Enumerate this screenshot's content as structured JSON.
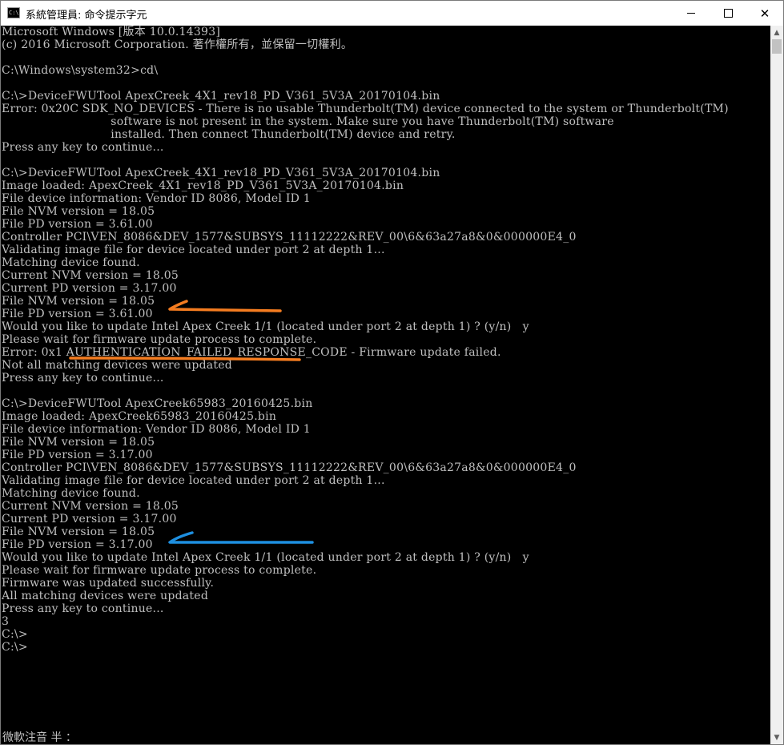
{
  "window": {
    "title": "系統管理員: 命令提示字元",
    "icon_name": "console-app-icon",
    "controls": {
      "minimize_icon": "minimize-icon",
      "maximize_icon": "maximize-icon",
      "close_icon": "close-icon"
    }
  },
  "console": {
    "lines": [
      "Microsoft Windows [版本 10.0.14393]",
      "(c) 2016 Microsoft Corporation. 著作權所有，並保留一切權利。",
      "",
      "C:\\Windows\\system32>cd\\",
      "",
      "C:\\>DeviceFWUTool ApexCreek_4X1_rev18_PD_V361_5V3A_20170104.bin",
      "Error: 0x20C SDK_NO_DEVICES - There is no usable Thunderbolt(TM) device connected to the system or Thunderbolt(TM)",
      "                             software is not present in the system. Make sure you have Thunderbolt(TM) software",
      "                             installed. Then connect Thunderbolt(TM) device and retry.",
      "Press any key to continue...",
      "",
      "C:\\>DeviceFWUTool ApexCreek_4X1_rev18_PD_V361_5V3A_20170104.bin",
      "Image loaded: ApexCreek_4X1_rev18_PD_V361_5V3A_20170104.bin",
      "File device information: Vendor ID 8086, Model ID 1",
      "File NVM version = 18.05",
      "File PD version = 3.61.00",
      "Controller PCI\\VEN_8086&DEV_1577&SUBSYS_11112222&REV_00\\6&63a27a8&0&000000E4_0",
      "Validating image file for device located under port 2 at depth 1...",
      "Matching device found.",
      "Current NVM version = 18.05",
      "Current PD version = 3.17.00",
      "File NVM version = 18.05",
      "File PD version = 3.61.00",
      "Would you like to update Intel Apex Creek 1/1 (located under port 2 at depth 1) ? (y/n)   y",
      "Please wait for firmware update process to complete.",
      "Error: 0x1 AUTHENTICATION_FAILED_RESPONSE_CODE - Firmware update failed.",
      "Not all matching devices were updated",
      "Press any key to continue...",
      "",
      "C:\\>DeviceFWUTool ApexCreek65983_20160425.bin",
      "Image loaded: ApexCreek65983_20160425.bin",
      "File device information: Vendor ID 8086, Model ID 1",
      "File NVM version = 18.05",
      "File PD version = 3.17.00",
      "Controller PCI\\VEN_8086&DEV_1577&SUBSYS_11112222&REV_00\\6&63a27a8&0&000000E4_0",
      "Validating image file for device located under port 2 at depth 1...",
      "Matching device found.",
      "Current NVM version = 18.05",
      "Current PD version = 3.17.00",
      "File NVM version = 18.05",
      "File PD version = 3.17.00",
      "Would you like to update Intel Apex Creek 1/1 (located under port 2 at depth 1) ? (y/n)   y",
      "Please wait for firmware update process to complete.",
      "Firmware was updated successfully.",
      "All matching devices were updated",
      "Press any key to continue...",
      "3",
      "C:\\>",
      "C:\\>"
    ],
    "ime_status": "微軟注音 半 ："
  },
  "colors": {
    "console_background": "#000000",
    "console_text": "#c0c0c0",
    "annotation_orange": "#f47c20",
    "annotation_blue": "#1e8fe0"
  },
  "scrollbar": {
    "up_icon": "scroll-up-arrow-icon",
    "down_icon": "scroll-down-arrow-icon"
  }
}
